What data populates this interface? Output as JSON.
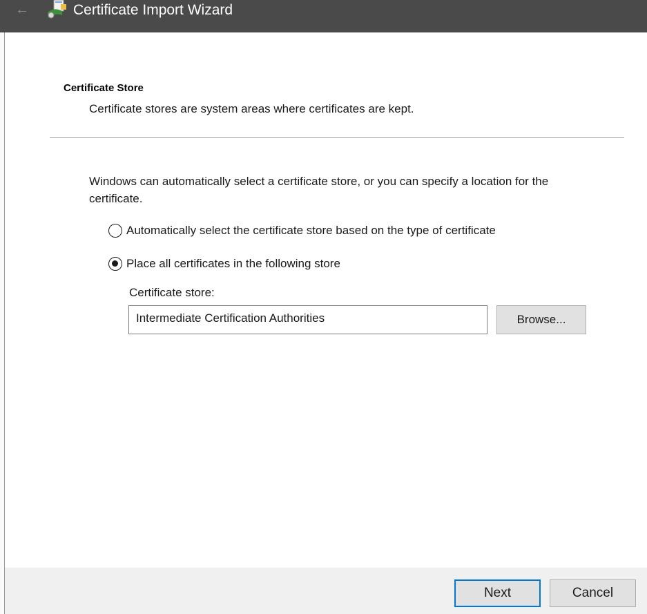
{
  "window": {
    "title": "Certificate Import Wizard",
    "back_icon": "back-arrow-icon",
    "app_icon": "certificate-wizard-icon"
  },
  "header": {
    "heading": "Certificate Store",
    "description": "Certificate stores are system areas where certificates are kept."
  },
  "body": {
    "intro": "Windows can automatically select a certificate store, or you can specify a location for the certificate.",
    "options": [
      {
        "label": "Automatically select the certificate store based on the type of certificate",
        "selected": false
      },
      {
        "label": "Place all certificates in the following store",
        "selected": true
      }
    ],
    "store_label": "Certificate store:",
    "store_value": "Intermediate Certification Authorities",
    "browse_label": "Browse..."
  },
  "footer": {
    "next_label": "Next",
    "cancel_label": "Cancel"
  },
  "colors": {
    "titlebar": "#4a4a4a",
    "focus_border": "#0078d7",
    "button_face": "#e1e1e1",
    "footer_bg": "#f0f0f0"
  }
}
